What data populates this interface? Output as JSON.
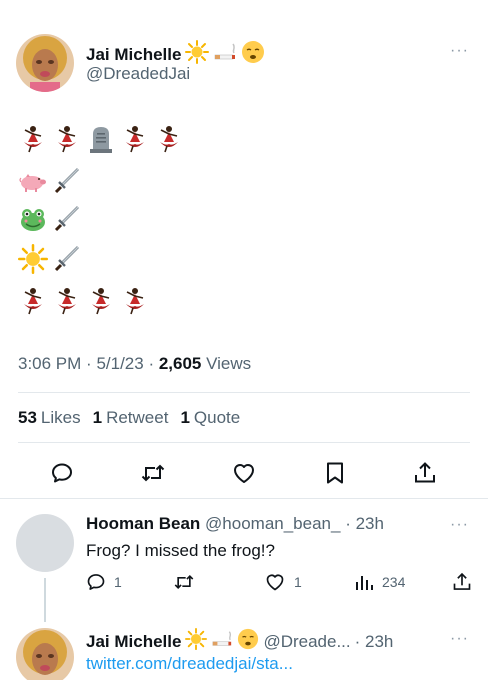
{
  "tweet": {
    "author_name": "Jai Michelle",
    "author_handle": "@DreadedJai",
    "name_emojis": [
      "sun-emoji",
      "cigarette-emoji",
      "relieved-face-emoji"
    ],
    "body_rows": [
      [
        "dancer-emoji",
        "dancer-emoji",
        "headstone-emoji",
        "dancer-emoji",
        "dancer-emoji"
      ],
      [
        "pig-emoji",
        "dagger-emoji"
      ],
      [
        "frog-emoji",
        "dagger-emoji"
      ],
      [
        "sun-emoji",
        "dagger-emoji"
      ],
      [
        "dancer-emoji",
        "dancer-emoji",
        "dancer-emoji",
        "dancer-emoji"
      ]
    ],
    "time": "3:06 PM",
    "date": "5/1/23",
    "views_count": "2,605",
    "views_label": "Views",
    "likes_count": "53",
    "likes_label": "Likes",
    "retweets_count": "1",
    "retweets_label": "Retweet",
    "quotes_count": "1",
    "quotes_label": "Quote",
    "more_label": "···"
  },
  "actions": [
    "reply-icon",
    "retweet-icon",
    "like-icon",
    "bookmark-icon",
    "share-icon"
  ],
  "reply": {
    "name": "Hooman Bean",
    "handle": "@hooman_bean_",
    "time": "· 23h",
    "text": "Frog? I missed the frog!?",
    "reply_count": "1",
    "like_count": "1",
    "views_count": "234",
    "more_label": "···"
  },
  "third": {
    "name": "Jai Michelle",
    "handle": "@Dreade...",
    "time": "· 23h",
    "link": "twitter.com/dreadedjai/sta...",
    "more_label": "···"
  },
  "colors": {
    "text": "#0f1419",
    "secondary": "#536471",
    "link": "#1d9bf0",
    "divider": "#e3e8ec"
  }
}
